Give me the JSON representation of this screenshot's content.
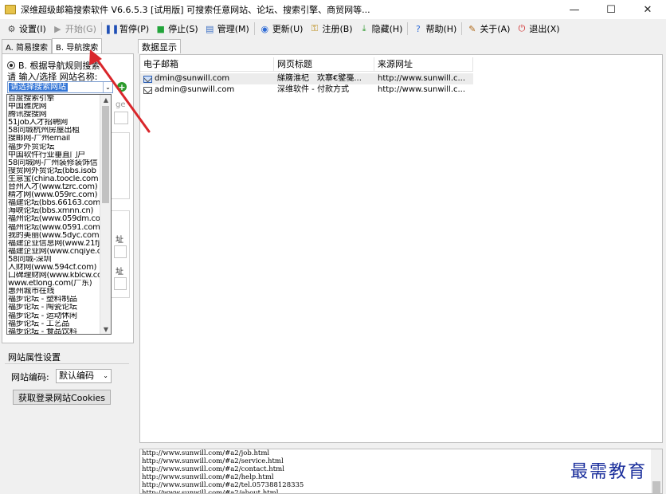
{
  "window": {
    "title": "深维超级邮箱搜索软件 V6.6.5.3 [试用版] 可搜索任意网站、论坛、搜索引擎、商贸网等...",
    "controls": {
      "minimize": "—",
      "maximize": "☐",
      "close": "✕"
    }
  },
  "toolbar": {
    "items": [
      {
        "label": "设置(I)",
        "icon": "gear-icon",
        "glyph": "⚙",
        "color": "#4a4a4a",
        "disabled": false
      },
      {
        "label": "开始(G)",
        "icon": "play-icon",
        "glyph": "▶",
        "color": "#9a9a9a",
        "disabled": true
      },
      {
        "label": "暂停(P)",
        "icon": "pause-icon",
        "glyph": "❚❚",
        "color": "#1f4fb5",
        "disabled": false
      },
      {
        "label": "停止(S)",
        "icon": "stop-icon",
        "glyph": "■",
        "color": "#22a43a",
        "disabled": false
      },
      {
        "label": "管理(M)",
        "icon": "document-icon",
        "glyph": "▤",
        "color": "#3b6fc4",
        "disabled": false
      },
      {
        "label": "更新(U)",
        "icon": "globe-icon",
        "glyph": "◉",
        "color": "#2e6bd6",
        "disabled": false
      },
      {
        "label": "注册(B)",
        "icon": "key-icon",
        "glyph": "⚿",
        "color": "#b8860b",
        "disabled": false
      },
      {
        "label": "隐藏(H)",
        "icon": "download-icon",
        "glyph": "⤓",
        "color": "#2e9a2e",
        "disabled": false
      },
      {
        "label": "帮助(H)",
        "icon": "help-icon",
        "glyph": "?",
        "color": "#2e6bd6",
        "disabled": false
      },
      {
        "label": "关于(A)",
        "icon": "about-icon",
        "glyph": "✎",
        "color": "#b06a1a",
        "disabled": false
      },
      {
        "label": "退出(X)",
        "icon": "power-icon",
        "glyph": "⏻",
        "color": "#d12b2b",
        "disabled": false
      }
    ]
  },
  "left_tabs": [
    "A. 简易搜索",
    "B. 导航搜索"
  ],
  "nav": {
    "radio_label": "B. 根据导航规则搜索",
    "site_label": "请 输入/选择 网站名称:",
    "selected_value": "请选择搜索网站",
    "dropdown_items": [
      "百度搜索引擎",
      "中国雅虎网",
      "腾讯搜搜网",
      "51job人才招聘网",
      "58同城杭州房屋出租",
      "搜邮网-广州email",
      "福步外贸论坛",
      "中国软件行业垂直门户",
      "58同城网-广州装修装饰信",
      "搜贸网外贸论坛(bbs.isob",
      "生意宝(china.toocle.com",
      "台州人才(www.tzrc.com)",
      "精才网(www.059rc.com)",
      "福建论坛(bbs.66163.com)",
      "海峡论坛(bbs.xmnn.cn)",
      "福州论坛(www.059dm.com)",
      "福州论坛(www.0591.com)",
      "我的美丽(www.5dyc.com)",
      "福建企业信息网(www.21fj",
      "福建企业网(www.cnqiye.c",
      "58同城-深圳",
      "人财网(www.594cf.com)",
      "口碑理财网(www.kblcw.cc",
      "www.etlong.com(广东)",
      "惠州城市在线",
      "福步论坛 - 塑料制品",
      "福步论坛 - 陶瓷论坛",
      "福步论坛 - 运动休闲",
      "福步论坛 - 工艺品",
      "福步论坛 - 食品饮料"
    ],
    "hidden_fragments": [
      "ge",
      "址",
      "址"
    ]
  },
  "site_props": {
    "title": "网站属性设置",
    "encoding_label": "网站编码:",
    "encoding_value": "默认编码",
    "cookie_button": "获取登录网站Cookies"
  },
  "results": {
    "tab_label": "数据显示",
    "columns": [
      "电子邮箱",
      "网页标题",
      "来源网址"
    ],
    "rows": [
      {
        "email": "dmin@sunwill.com",
        "title": "綈簰淮杞　欢寨€鐾戞...",
        "url": "http://www.sunwill.c...",
        "selected": true
      },
      {
        "email": "admin@sunwill.com",
        "title": "深维软件 - 付款方式",
        "url": "http://www.sunwill.c...",
        "selected": false
      }
    ]
  },
  "log": {
    "lines": [
      "http://www.sunwill.com/#a2/job.html",
      "http://www.sunwill.com/#a2/service.html",
      "http://www.sunwill.com/#a2/contact.html",
      "http://www.sunwill.com/#a2/help.html",
      "http://www.sunwill.com/#a2/tel.057388128335",
      "http://www.sunwill.com/#a2/about.html"
    ]
  },
  "watermark": "最需教育",
  "colors": {
    "selection_blue": "#3375d6",
    "arrow_red": "#d9262b",
    "watermark_blue": "#1b2f9c"
  }
}
